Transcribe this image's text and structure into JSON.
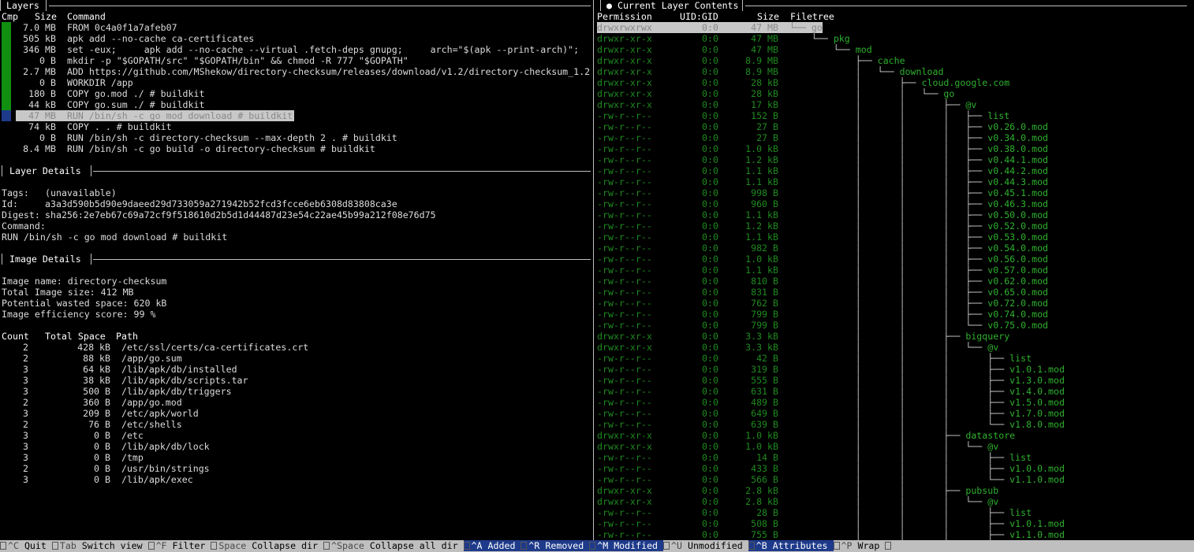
{
  "layers_panel": {
    "title": "Layers",
    "headers": {
      "cmp": "Cmp",
      "size": "Size",
      "command": "Command"
    },
    "rows": [
      {
        "size": "7.0 MB",
        "command": "FROM 0c4a0f1a7afeb07",
        "bar": "green"
      },
      {
        "size": "505 kB",
        "command": "apk add --no-cache ca-certificates",
        "bar": "green"
      },
      {
        "size": "346 MB",
        "command": "set -eux;     apk add --no-cache --virtual .fetch-deps gnupg;     arch=\"$(apk --print-arch)\";",
        "bar": "green"
      },
      {
        "size": "0 B",
        "command": "mkdir -p \"$GOPATH/src\" \"$GOPATH/bin\" && chmod -R 777 \"$GOPATH\"",
        "bar": "green"
      },
      {
        "size": "2.7 MB",
        "command": "ADD https://github.com/MShekow/directory-checksum/releases/download/v1.2/directory-checksum_1.2",
        "bar": "green"
      },
      {
        "size": "0 B",
        "command": "WORKDIR /app",
        "bar": "green"
      },
      {
        "size": "180 B",
        "command": "COPY go.mod ./ # buildkit",
        "bar": "green"
      },
      {
        "size": "44 kB",
        "command": "COPY go.sum ./ # buildkit",
        "bar": "green"
      },
      {
        "size": "47 MB",
        "command": "RUN /bin/sh -c go mod download # buildkit",
        "bar": "blue",
        "selected": true
      },
      {
        "size": "74 kB",
        "command": "COPY . . # buildkit",
        "bar": "none"
      },
      {
        "size": "0 B",
        "command": "RUN /bin/sh -c directory-checksum --max-depth 2 . # buildkit",
        "bar": "none"
      },
      {
        "size": "8.4 MB",
        "command": "RUN /bin/sh -c go build -o directory-checksum # buildkit",
        "bar": "none"
      }
    ]
  },
  "layer_details": {
    "title": "Layer Details",
    "tags_label": "Tags:",
    "tags_value": "(unavailable)",
    "id_label": "Id:",
    "id_value": "a3a3d590b5d90e9daeed29d733059a271942b52fcd3fcce6eb6308d83808ca3e",
    "digest_label": "Digest:",
    "digest_value": "sha256:2e7eb67c69a72cf9f518610d2b5d1d44487d23e54c22ae45b99a212f08e76d75",
    "command_label": "Command:",
    "command_value": "RUN /bin/sh -c go mod download # buildkit"
  },
  "image_details": {
    "title": "Image Details",
    "name_label": "Image name:",
    "name_value": "directory-checksum",
    "size_label": "Total Image size:",
    "size_value": "412 MB",
    "wasted_label": "Potential wasted space:",
    "wasted_value": "620 kB",
    "efficiency_label": "Image efficiency score:",
    "efficiency_value": "99 %",
    "headers": {
      "count": "Count",
      "space": "Total Space",
      "path": "Path"
    },
    "rows": [
      {
        "count": "2",
        "space": "428 kB",
        "path": "/etc/ssl/certs/ca-certificates.crt"
      },
      {
        "count": "2",
        "space": "88 kB",
        "path": "/app/go.sum"
      },
      {
        "count": "3",
        "space": "64 kB",
        "path": "/lib/apk/db/installed"
      },
      {
        "count": "3",
        "space": "38 kB",
        "path": "/lib/apk/db/scripts.tar"
      },
      {
        "count": "3",
        "space": "500 B",
        "path": "/lib/apk/db/triggers"
      },
      {
        "count": "2",
        "space": "360 B",
        "path": "/app/go.mod"
      },
      {
        "count": "3",
        "space": "209 B",
        "path": "/etc/apk/world"
      },
      {
        "count": "2",
        "space": "76 B",
        "path": "/etc/shells"
      },
      {
        "count": "3",
        "space": "0 B",
        "path": "/etc"
      },
      {
        "count": "3",
        "space": "0 B",
        "path": "/lib/apk/db/lock"
      },
      {
        "count": "3",
        "space": "0 B",
        "path": "/tmp"
      },
      {
        "count": "2",
        "space": "0 B",
        "path": "/usr/bin/strings"
      },
      {
        "count": "3",
        "space": "0 B",
        "path": "/lib/apk/exec"
      }
    ]
  },
  "contents_panel": {
    "title": "● Current Layer Contents",
    "headers": {
      "perm": "Permission",
      "uid": "UID:GID",
      "size": "Size",
      "tree": "Filetree"
    },
    "rows": [
      {
        "perm": "drwxrwxrwx",
        "uid": "0:0",
        "size": "47 MB",
        "prefix": "└── ",
        "name": "go",
        "selected": true
      },
      {
        "perm": "drwxr-xr-x",
        "uid": "0:0",
        "size": "47 MB",
        "prefix": "    └── ",
        "name": "pkg"
      },
      {
        "perm": "drwxr-xr-x",
        "uid": "0:0",
        "size": "47 MB",
        "prefix": "        └── ",
        "name": "mod"
      },
      {
        "perm": "drwxr-xr-x",
        "uid": "0:0",
        "size": "8.9 MB",
        "prefix": "            ├── ",
        "name": "cache"
      },
      {
        "perm": "drwxr-xr-x",
        "uid": "0:0",
        "size": "8.9 MB",
        "prefix": "            │   └── ",
        "name": "download"
      },
      {
        "perm": "drwxr-xr-x",
        "uid": "0:0",
        "size": "28 kB",
        "prefix": "            │       ├── ",
        "name": "cloud.google.com"
      },
      {
        "perm": "drwxr-xr-x",
        "uid": "0:0",
        "size": "28 kB",
        "prefix": "            │       │   └── ",
        "name": "go"
      },
      {
        "perm": "drwxr-xr-x",
        "uid": "0:0",
        "size": "17 kB",
        "prefix": "            │       │       ├── ",
        "name": "@v"
      },
      {
        "perm": "-rw-r--r--",
        "uid": "0:0",
        "size": "152 B",
        "prefix": "            │       │       │   ├── ",
        "name": "list"
      },
      {
        "perm": "-rw-r--r--",
        "uid": "0:0",
        "size": "27 B",
        "prefix": "            │       │       │   ├── ",
        "name": "v0.26.0.mod"
      },
      {
        "perm": "-rw-r--r--",
        "uid": "0:0",
        "size": "27 B",
        "prefix": "            │       │       │   ├── ",
        "name": "v0.34.0.mod"
      },
      {
        "perm": "-rw-r--r--",
        "uid": "0:0",
        "size": "1.0 kB",
        "prefix": "            │       │       │   ├── ",
        "name": "v0.38.0.mod"
      },
      {
        "perm": "-rw-r--r--",
        "uid": "0:0",
        "size": "1.2 kB",
        "prefix": "            │       │       │   ├── ",
        "name": "v0.44.1.mod"
      },
      {
        "perm": "-rw-r--r--",
        "uid": "0:0",
        "size": "1.1 kB",
        "prefix": "            │       │       │   ├── ",
        "name": "v0.44.2.mod"
      },
      {
        "perm": "-rw-r--r--",
        "uid": "0:0",
        "size": "1.1 kB",
        "prefix": "            │       │       │   ├── ",
        "name": "v0.44.3.mod"
      },
      {
        "perm": "-rw-r--r--",
        "uid": "0:0",
        "size": "998 B",
        "prefix": "            │       │       │   ├── ",
        "name": "v0.45.1.mod"
      },
      {
        "perm": "-rw-r--r--",
        "uid": "0:0",
        "size": "960 B",
        "prefix": "            │       │       │   ├── ",
        "name": "v0.46.3.mod"
      },
      {
        "perm": "-rw-r--r--",
        "uid": "0:0",
        "size": "1.1 kB",
        "prefix": "            │       │       │   ├── ",
        "name": "v0.50.0.mod"
      },
      {
        "perm": "-rw-r--r--",
        "uid": "0:0",
        "size": "1.2 kB",
        "prefix": "            │       │       │   ├── ",
        "name": "v0.52.0.mod"
      },
      {
        "perm": "-rw-r--r--",
        "uid": "0:0",
        "size": "1.1 kB",
        "prefix": "            │       │       │   ├── ",
        "name": "v0.53.0.mod"
      },
      {
        "perm": "-rw-r--r--",
        "uid": "0:0",
        "size": "982 B",
        "prefix": "            │       │       │   ├── ",
        "name": "v0.54.0.mod"
      },
      {
        "perm": "-rw-r--r--",
        "uid": "0:0",
        "size": "1.0 kB",
        "prefix": "            │       │       │   ├── ",
        "name": "v0.56.0.mod"
      },
      {
        "perm": "-rw-r--r--",
        "uid": "0:0",
        "size": "1.1 kB",
        "prefix": "            │       │       │   ├── ",
        "name": "v0.57.0.mod"
      },
      {
        "perm": "-rw-r--r--",
        "uid": "0:0",
        "size": "810 B",
        "prefix": "            │       │       │   ├── ",
        "name": "v0.62.0.mod"
      },
      {
        "perm": "-rw-r--r--",
        "uid": "0:0",
        "size": "831 B",
        "prefix": "            │       │       │   ├── ",
        "name": "v0.65.0.mod"
      },
      {
        "perm": "-rw-r--r--",
        "uid": "0:0",
        "size": "762 B",
        "prefix": "            │       │       │   ├── ",
        "name": "v0.72.0.mod"
      },
      {
        "perm": "-rw-r--r--",
        "uid": "0:0",
        "size": "799 B",
        "prefix": "            │       │       │   ├── ",
        "name": "v0.74.0.mod"
      },
      {
        "perm": "-rw-r--r--",
        "uid": "0:0",
        "size": "799 B",
        "prefix": "            │       │       │   └── ",
        "name": "v0.75.0.mod"
      },
      {
        "perm": "drwxr-xr-x",
        "uid": "0:0",
        "size": "3.3 kB",
        "prefix": "            │       │       ├── ",
        "name": "bigquery"
      },
      {
        "perm": "drwxr-xr-x",
        "uid": "0:0",
        "size": "3.3 kB",
        "prefix": "            │       │       │   └── ",
        "name": "@v"
      },
      {
        "perm": "-rw-r--r--",
        "uid": "0:0",
        "size": "42 B",
        "prefix": "            │       │       │       ├── ",
        "name": "list"
      },
      {
        "perm": "-rw-r--r--",
        "uid": "0:0",
        "size": "319 B",
        "prefix": "            │       │       │       ├── ",
        "name": "v1.0.1.mod"
      },
      {
        "perm": "-rw-r--r--",
        "uid": "0:0",
        "size": "555 B",
        "prefix": "            │       │       │       ├── ",
        "name": "v1.3.0.mod"
      },
      {
        "perm": "-rw-r--r--",
        "uid": "0:0",
        "size": "631 B",
        "prefix": "            │       │       │       ├── ",
        "name": "v1.4.0.mod"
      },
      {
        "perm": "-rw-r--r--",
        "uid": "0:0",
        "size": "489 B",
        "prefix": "            │       │       │       ├── ",
        "name": "v1.5.0.mod"
      },
      {
        "perm": "-rw-r--r--",
        "uid": "0:0",
        "size": "649 B",
        "prefix": "            │       │       │       ├── ",
        "name": "v1.7.0.mod"
      },
      {
        "perm": "-rw-r--r--",
        "uid": "0:0",
        "size": "639 B",
        "prefix": "            │       │       │       └── ",
        "name": "v1.8.0.mod"
      },
      {
        "perm": "drwxr-xr-x",
        "uid": "0:0",
        "size": "1.0 kB",
        "prefix": "            │       │       ├── ",
        "name": "datastore"
      },
      {
        "perm": "drwxr-xr-x",
        "uid": "0:0",
        "size": "1.0 kB",
        "prefix": "            │       │       │   └── ",
        "name": "@v"
      },
      {
        "perm": "-rw-r--r--",
        "uid": "0:0",
        "size": "14 B",
        "prefix": "            │       │       │       ├── ",
        "name": "list"
      },
      {
        "perm": "-rw-r--r--",
        "uid": "0:0",
        "size": "433 B",
        "prefix": "            │       │       │       ├── ",
        "name": "v1.0.0.mod"
      },
      {
        "perm": "-rw-r--r--",
        "uid": "0:0",
        "size": "566 B",
        "prefix": "            │       │       │       └── ",
        "name": "v1.1.0.mod"
      },
      {
        "perm": "drwxr-xr-x",
        "uid": "0:0",
        "size": "2.8 kB",
        "prefix": "            │       │       ├── ",
        "name": "pubsub"
      },
      {
        "perm": "drwxr-xr-x",
        "uid": "0:0",
        "size": "2.8 kB",
        "prefix": "            │       │       │   └── ",
        "name": "@v"
      },
      {
        "perm": "-rw-r--r--",
        "uid": "0:0",
        "size": "28 B",
        "prefix": "            │       │       │       ├── ",
        "name": "list"
      },
      {
        "perm": "-rw-r--r--",
        "uid": "0:0",
        "size": "508 B",
        "prefix": "            │       │       │       ├── ",
        "name": "v1.0.1.mod"
      },
      {
        "perm": "-rw-r--r--",
        "uid": "0:0",
        "size": "755 B",
        "prefix": "            │       │       │       ├── ",
        "name": "v1.1.0.mod"
      }
    ]
  },
  "footer": [
    {
      "key": "^C",
      "label": "Quit",
      "style": "normal"
    },
    {
      "key": "Tab",
      "label": "Switch view",
      "style": "normal"
    },
    {
      "key": "^F",
      "label": "Filter",
      "style": "normal"
    },
    {
      "key": "Space",
      "label": "Collapse dir",
      "style": "normal"
    },
    {
      "key": "^Space",
      "label": "Collapse all dir",
      "style": "normal"
    },
    {
      "key": "^A",
      "label": "Added",
      "style": "on"
    },
    {
      "key": "^R",
      "label": "Removed",
      "style": "on"
    },
    {
      "key": "^M",
      "label": "Modified",
      "style": "on"
    },
    {
      "key": "^U",
      "label": "Unmodified",
      "style": "normal"
    },
    {
      "key": "^B",
      "label": "Attributes",
      "style": "on"
    },
    {
      "key": "^P",
      "label": "Wrap",
      "style": "normal"
    }
  ],
  "colors": {
    "bar_green": "#108f10",
    "bar_blue": "#1e3a8a",
    "file_green": "#2fb02f",
    "perm_green": "#1f8a1f"
  }
}
